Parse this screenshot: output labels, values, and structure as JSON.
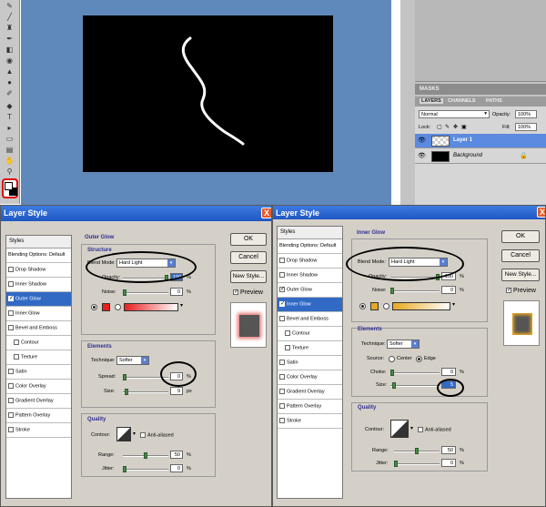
{
  "layers_panel": {
    "masks_tab": "MASKS",
    "tabs": [
      "LAYERS",
      "CHANNELS",
      "PATHS"
    ],
    "blend_mode": "Normal",
    "opacity_label": "Opacity:",
    "opacity_value": "100%",
    "lock_label": "Lock:",
    "fill_label": "Fill:",
    "fill_value": "100%",
    "layers": [
      {
        "name": "Layer 1",
        "selected": true
      },
      {
        "name": "Background",
        "selected": false
      }
    ]
  },
  "dialog_left": {
    "title": "Layer Style",
    "styles_header": "Styles",
    "styles": [
      {
        "label": "Blending Options: Default",
        "checkbox": false,
        "checked": false,
        "selected": false,
        "indent": false
      },
      {
        "label": "Drop Shadow",
        "checkbox": true,
        "checked": false,
        "selected": false,
        "indent": false
      },
      {
        "label": "Inner Shadow",
        "checkbox": true,
        "checked": false,
        "selected": false,
        "indent": false
      },
      {
        "label": "Outer Glow",
        "checkbox": true,
        "checked": true,
        "selected": true,
        "indent": false
      },
      {
        "label": "Inner Glow",
        "checkbox": true,
        "checked": false,
        "selected": false,
        "indent": false
      },
      {
        "label": "Bevel and Emboss",
        "checkbox": true,
        "checked": false,
        "selected": false,
        "indent": false
      },
      {
        "label": "Contour",
        "checkbox": true,
        "checked": false,
        "selected": false,
        "indent": true
      },
      {
        "label": "Texture",
        "checkbox": true,
        "checked": false,
        "selected": false,
        "indent": true
      },
      {
        "label": "Satin",
        "checkbox": true,
        "checked": false,
        "selected": false,
        "indent": false
      },
      {
        "label": "Color Overlay",
        "checkbox": true,
        "checked": false,
        "selected": false,
        "indent": false
      },
      {
        "label": "Gradient Overlay",
        "checkbox": true,
        "checked": false,
        "selected": false,
        "indent": false
      },
      {
        "label": "Pattern Overlay",
        "checkbox": true,
        "checked": false,
        "selected": false,
        "indent": false
      },
      {
        "label": "Stroke",
        "checkbox": true,
        "checked": false,
        "selected": false,
        "indent": false
      }
    ],
    "section_title": "Outer Glow",
    "structure_title": "Structure",
    "blend_mode_label": "Blend Mode:",
    "blend_mode_value": "Hard Light",
    "opacity_label": "Opacity:",
    "opacity_value": "100",
    "opacity_level": 1.0,
    "noise_label": "Noise:",
    "noise_value": "0",
    "noise_level": 0.0,
    "percent": "%",
    "glow_color": "#e82020",
    "elements_title": "Elements",
    "technique_label": "Technique:",
    "technique_value": "Softer",
    "spread_label": "Spread:",
    "spread_value": "0",
    "spread_level": 0.0,
    "size_label": "Size:",
    "size_value": "9",
    "size_level": 0.05,
    "px": "px",
    "quality_title": "Quality",
    "contour_label": "Contour:",
    "anti_aliased_label": "Anti-aliased",
    "range_label": "Range:",
    "range_value": "50",
    "range_level": 0.5,
    "jitter_label": "Jitter:",
    "jitter_value": "0",
    "jitter_level": 0.0,
    "ok_label": "OK",
    "cancel_label": "Cancel",
    "new_style_label": "New Style...",
    "preview_label": "Preview",
    "preview_checked": true
  },
  "dialog_right": {
    "title": "Layer Style",
    "styles_header": "Styles",
    "styles": [
      {
        "label": "Blending Options: Default",
        "checkbox": false,
        "checked": false,
        "selected": false,
        "indent": false
      },
      {
        "label": "Drop Shadow",
        "checkbox": true,
        "checked": false,
        "selected": false,
        "indent": false
      },
      {
        "label": "Inner Shadow",
        "checkbox": true,
        "checked": false,
        "selected": false,
        "indent": false
      },
      {
        "label": "Outer Glow",
        "checkbox": true,
        "checked": true,
        "selected": false,
        "indent": false
      },
      {
        "label": "Inner Glow",
        "checkbox": true,
        "checked": true,
        "selected": true,
        "indent": false
      },
      {
        "label": "Bevel and Emboss",
        "checkbox": true,
        "checked": false,
        "selected": false,
        "indent": false
      },
      {
        "label": "Contour",
        "checkbox": true,
        "checked": false,
        "selected": false,
        "indent": true
      },
      {
        "label": "Texture",
        "checkbox": true,
        "checked": false,
        "selected": false,
        "indent": true
      },
      {
        "label": "Satin",
        "checkbox": true,
        "checked": false,
        "selected": false,
        "indent": false
      },
      {
        "label": "Color Overlay",
        "checkbox": true,
        "checked": false,
        "selected": false,
        "indent": false
      },
      {
        "label": "Gradient Overlay",
        "checkbox": true,
        "checked": false,
        "selected": false,
        "indent": false
      },
      {
        "label": "Pattern Overlay",
        "checkbox": true,
        "checked": false,
        "selected": false,
        "indent": false
      },
      {
        "label": "Stroke",
        "checkbox": true,
        "checked": false,
        "selected": false,
        "indent": false
      }
    ],
    "section_title": "Inner Glow",
    "blend_mode_label": "Blend Mode:",
    "blend_mode_value": "Hard Light",
    "opacity_label": "Opacity:",
    "opacity_value": "100",
    "opacity_level": 1.0,
    "noise_label": "Noise:",
    "noise_value": "0",
    "noise_level": 0.0,
    "percent": "%",
    "glow_color": "#e8a820",
    "elements_title": "Elements",
    "technique_label": "Technique:",
    "technique_value": "Softer",
    "source_label": "Source:",
    "center_label": "Center",
    "edge_label": "Edge",
    "choke_label": "Choke:",
    "choke_value": "0",
    "choke_level": 0.0,
    "size_label": "Size:",
    "size_value": "5",
    "size_level": 0.03,
    "quality_title": "Quality",
    "contour_label": "Contour:",
    "anti_aliased_label": "Anti-aliased",
    "range_label": "Range:",
    "range_value": "50",
    "range_level": 0.5,
    "jitter_label": "Jitter:",
    "jitter_value": "0",
    "jitter_level": 0.0,
    "ok_label": "OK",
    "cancel_label": "Cancel",
    "new_style_label": "New Style...",
    "preview_label": "Preview",
    "preview_checked": true
  },
  "colors": {
    "canvas_bg": "#6089bb",
    "selection": "#316ac5",
    "title_bar": "#1e56c2"
  }
}
